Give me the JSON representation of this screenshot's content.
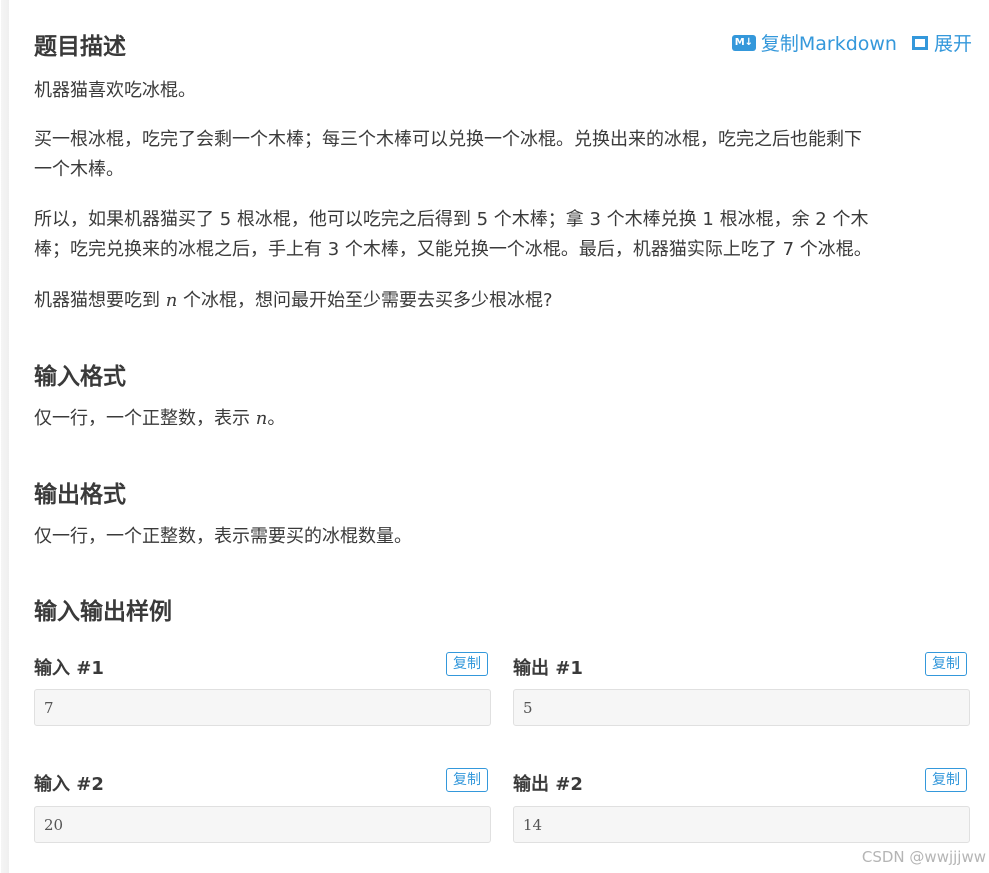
{
  "problem": {
    "title": "题目描述",
    "copy_markdown": "复制Markdown",
    "expand": "展开",
    "para1": "机器猫喜欢吃冰棍。",
    "para2_line1": "买一根冰棍，吃完了会剩一个木棒；每三个木棒可以兑换一个冰棍。兑换出来的冰棍，吃完之后也能剩下",
    "para2_line2": "一个木棒。",
    "para3_line1": "所以，如果机器猫买了 5 根冰棍，他可以吃完之后得到 5 个木棒；拿 3 个木棒兑换 1 根冰棍，余 2 个木",
    "para3_line2": "棒；吃完兑换来的冰棍之后，手上有 3 个木棒，又能兑换一个冰棍。最后，机器猫实际上吃了 7 个冰棍。",
    "para4_a": "机器猫想要吃到 ",
    "para4_var": "n",
    "para4_b": " 个冰棍，想问最开始至少需要去买多少根冰棍?"
  },
  "input_format": {
    "title": "输入格式",
    "text_a": "仅一行，一个正整数，表示 ",
    "text_var": "n",
    "text_b": "。"
  },
  "output_format": {
    "title": "输出格式",
    "text": "仅一行，一个正整数，表示需要买的冰棍数量。"
  },
  "samples": {
    "title": "输入输出样例",
    "copy_label": "复制",
    "items": [
      {
        "input_label": "输入 #1",
        "input": "7",
        "output_label": "输出 #1",
        "output": "5"
      },
      {
        "input_label": "输入 #2",
        "input": "20",
        "output_label": "输出 #2",
        "output": "14"
      }
    ]
  },
  "watermark": "CSDN @wwjjjww",
  "colors": {
    "accent": "#3498db",
    "text": "#3a3a3a"
  },
  "icons": {
    "markdown": "markdown-icon",
    "expand": "expand-icon"
  }
}
